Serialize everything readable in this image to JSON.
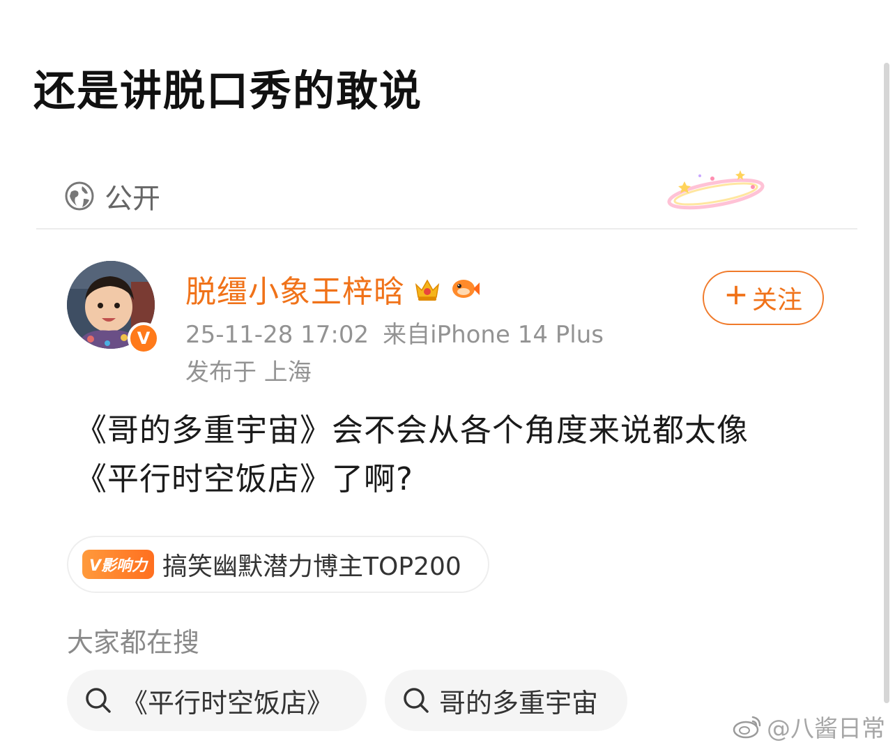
{
  "headline": "还是讲脱口秀的敢说",
  "post": {
    "visibility": "公开",
    "username": "脱缰小象王梓晗",
    "timestamp": "25-11-28 17:02",
    "source": "来自iPhone 14 Plus",
    "location": "发布于 上海",
    "follow_label": "关注",
    "text_line1": "《哥的多重宇宙》会不会从各个角度来说都太像",
    "text_line2": "《平行时空饭店》了啊?",
    "influence_tag": "V影响力",
    "influence_text": "搞笑幽默潜力博主TOP200"
  },
  "search": {
    "heading": "大家都在搜",
    "items": [
      "《平行时空饭店》",
      "哥的多重宇宙"
    ]
  },
  "watermark": "@八酱日常",
  "colors": {
    "accent_orange": "#f07219",
    "muted_text": "#939393",
    "chip_bg": "#f5f5f5"
  },
  "icons": [
    "globe-icon",
    "crown-icon",
    "fish-icon",
    "plus-icon",
    "search-icon",
    "weibo-logo"
  ]
}
